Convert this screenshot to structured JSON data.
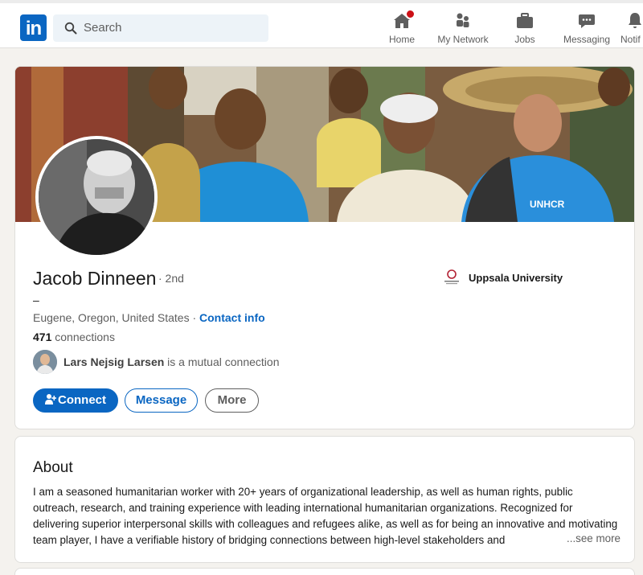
{
  "nav": {
    "logo_text": "in",
    "search_placeholder": "Search",
    "items": [
      {
        "label": "Home",
        "icon": "home-icon"
      },
      {
        "label": "My Network",
        "icon": "people-icon"
      },
      {
        "label": "Jobs",
        "icon": "briefcase-icon"
      },
      {
        "label": "Messaging",
        "icon": "chat-icon"
      },
      {
        "label": "Notif",
        "icon": "bell-icon"
      }
    ],
    "accent": "#0a66c2",
    "badge_color": "#cc1016"
  },
  "profile": {
    "name": "Jacob Dinneen",
    "degree": "· 2nd",
    "headline": "–",
    "location": "Eugene, Oregon, United States · ",
    "contact_label": "Contact info",
    "connections_count": "471",
    "connections_label": " connections",
    "mutual_name": "Lars Nejsig Larsen",
    "mutual_suffix": " is a mutual connection",
    "education": "Uppsala University",
    "buttons": {
      "connect": "Connect",
      "message": "Message",
      "more": "More"
    }
  },
  "about": {
    "title": "About",
    "text": "I am a seasoned humanitarian worker with 20+ years of organizational leadership, as well as human rights, public outreach, research, and training experience with leading international humanitarian organizations. Recognized for delivering superior interpersonal skills with colleagues and refugees alike, as well as for being an innovative and motivating team player, I have a verifiable history of bridging connections between high-level stakeholders and",
    "see_more": "...see more"
  }
}
